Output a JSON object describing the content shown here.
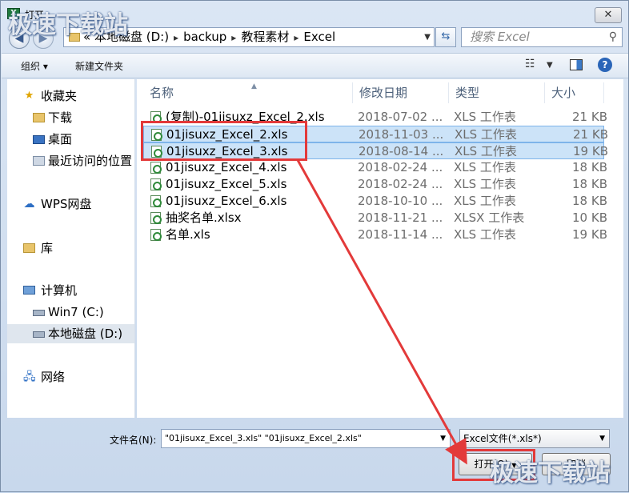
{
  "window": {
    "title": "打开",
    "close_glyph": "✕"
  },
  "address": {
    "prefix": "«",
    "segments": [
      "本地磁盘 (D:)",
      "backup",
      "教程素材",
      "Excel"
    ]
  },
  "search": {
    "placeholder": "搜索 Excel"
  },
  "toolbar": {
    "organize": "组织 ▾",
    "new_folder": "新建文件夹"
  },
  "sidebar": {
    "items": [
      {
        "label": "收藏夹",
        "icon": "star-icon"
      },
      {
        "label": "下载",
        "icon": "folder-icon"
      },
      {
        "label": "桌面",
        "icon": "desktop-icon"
      },
      {
        "label": "最近访问的位置",
        "icon": "recent-icon"
      },
      {
        "label": "WPS网盘",
        "icon": "cloud-icon"
      },
      {
        "label": "库",
        "icon": "library-icon"
      },
      {
        "label": "计算机",
        "icon": "computer-icon"
      },
      {
        "label": "Win7 (C:)",
        "icon": "drive-icon"
      },
      {
        "label": "本地磁盘 (D:)",
        "icon": "drive-icon",
        "selected": true
      },
      {
        "label": "网络",
        "icon": "network-icon"
      }
    ]
  },
  "columns": {
    "name": "名称",
    "date": "修改日期",
    "type": "类型",
    "size": "大小"
  },
  "files": [
    {
      "name": "(复制)-01jisuxz_Excel_2.xls",
      "date": "2018-07-02 ...",
      "type": "XLS 工作表",
      "size": "21 KB",
      "selected": false
    },
    {
      "name": "01jisuxz_Excel_2.xls",
      "date": "2018-11-03 ...",
      "type": "XLS 工作表",
      "size": "21 KB",
      "selected": true
    },
    {
      "name": "01jisuxz_Excel_3.xls",
      "date": "2018-08-14 ...",
      "type": "XLS 工作表",
      "size": "19 KB",
      "selected": true
    },
    {
      "name": "01jisuxz_Excel_4.xls",
      "date": "2018-02-24 ...",
      "type": "XLS 工作表",
      "size": "18 KB",
      "selected": false
    },
    {
      "name": "01jisuxz_Excel_5.xls",
      "date": "2018-02-24 ...",
      "type": "XLS 工作表",
      "size": "18 KB",
      "selected": false
    },
    {
      "name": "01jisuxz_Excel_6.xls",
      "date": "2018-10-10 ...",
      "type": "XLS 工作表",
      "size": "18 KB",
      "selected": false
    },
    {
      "name": "抽奖名单.xlsx",
      "date": "2018-11-21 ...",
      "type": "XLSX 工作表",
      "size": "10 KB",
      "selected": false
    },
    {
      "name": "名单.xls",
      "date": "2018-11-14 ...",
      "type": "XLS 工作表",
      "size": "19 KB",
      "selected": false
    }
  ],
  "footer": {
    "filename_label": "文件名(N):",
    "filename_value": "\"01jisuxz_Excel_3.xls\" \"01jisuxz_Excel_2.xls\"",
    "filetype": "Excel文件(*.xls*)",
    "open_button": "打开(O)",
    "cancel_button": "取消"
  },
  "watermark": "极速下载站",
  "colors": {
    "highlight": "#e33a3a",
    "selection": "#cce3f8"
  }
}
